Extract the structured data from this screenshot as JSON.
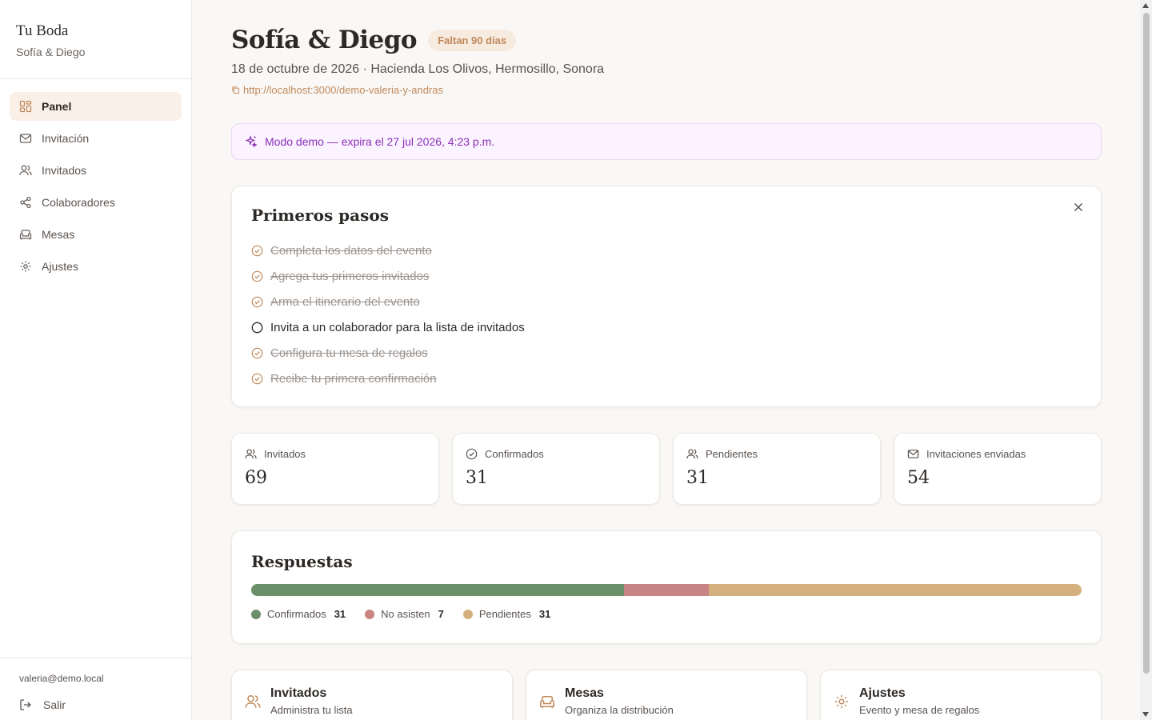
{
  "sidebar": {
    "brand_title": "Tu Boda",
    "brand_subtitle": "Sofía & Diego",
    "items": [
      {
        "label": "Panel",
        "icon": "dashboard-icon",
        "active": true
      },
      {
        "label": "Invitación",
        "icon": "mail-icon"
      },
      {
        "label": "Invitados",
        "icon": "users-icon"
      },
      {
        "label": "Colaboradores",
        "icon": "share-icon"
      },
      {
        "label": "Mesas",
        "icon": "sofa-icon"
      },
      {
        "label": "Ajustes",
        "icon": "gear-icon"
      }
    ],
    "user_email": "valeria@demo.local",
    "logout_label": "Salir"
  },
  "header": {
    "title": "Sofía & Diego",
    "countdown": "Faltan 90 días",
    "event_line": "18 de octubre de 2026 · Hacienda Los Olivos, Hermosillo, Sonora",
    "link": "http://localhost:3000/demo-valeria-y-andras"
  },
  "demo_banner": "Modo demo — expira el 27 jul 2026, 4:23 p.m.",
  "steps": {
    "title": "Primeros pasos",
    "items": [
      {
        "label": "Completa los datos del evento",
        "done": true
      },
      {
        "label": "Agrega tus primeros invitados",
        "done": true
      },
      {
        "label": "Arma el itinerario del evento",
        "done": true
      },
      {
        "label": "Invita a un colaborador para la lista de invitados",
        "done": false
      },
      {
        "label": "Configura tu mesa de regalos",
        "done": true
      },
      {
        "label": "Recibe tu primera confirmación",
        "done": true
      }
    ]
  },
  "stats": [
    {
      "label": "Invitados",
      "value": "69",
      "icon": "users-icon"
    },
    {
      "label": "Confirmados",
      "value": "31",
      "icon": "check-circle-icon"
    },
    {
      "label": "Pendientes",
      "value": "31",
      "icon": "users-icon"
    },
    {
      "label": "Invitaciones enviadas",
      "value": "54",
      "icon": "mail-icon"
    }
  ],
  "responses": {
    "title": "Respuestas",
    "segments": [
      {
        "label": "Confirmados",
        "count": "31",
        "color": "#6b8f68"
      },
      {
        "label": "No asisten",
        "count": "7",
        "color": "#c98585"
      },
      {
        "label": "Pendientes",
        "count": "31",
        "color": "#d4b07e"
      }
    ]
  },
  "links": [
    {
      "title": "Invitados",
      "subtitle": "Administra tu lista",
      "icon": "users-icon"
    },
    {
      "title": "Mesas",
      "subtitle": "Organiza la distribución",
      "icon": "sofa-icon"
    },
    {
      "title": "Ajustes",
      "subtitle": "Evento y mesa de regalos",
      "icon": "gear-icon"
    }
  ],
  "colors": {
    "accent": "#c0885a",
    "demo": "#8a2fb5"
  }
}
